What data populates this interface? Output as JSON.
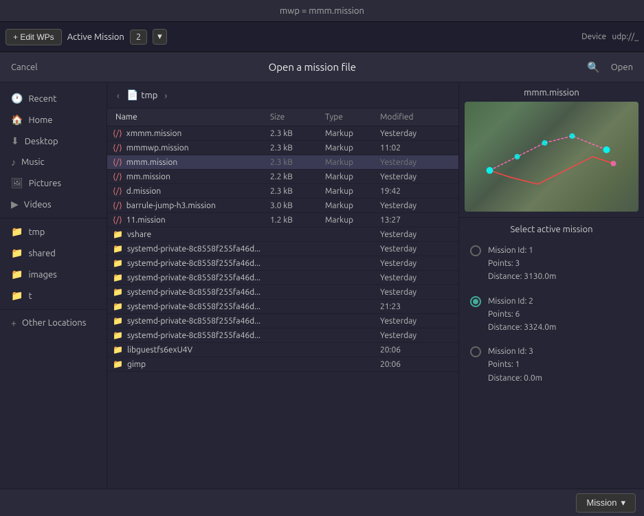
{
  "titleBar": {
    "text": "mwp = mmm.mission"
  },
  "toolbar": {
    "editWps": "+ Edit WPs",
    "activeMission": "Active Mission",
    "missionNum": "2",
    "device": "Device",
    "deviceAddr": "udp://_"
  },
  "dialog": {
    "cancel": "Cancel",
    "title": "Open a mission file",
    "open": "Open"
  },
  "pathBar": {
    "folder": "tmp"
  },
  "columns": {
    "name": "Name",
    "size": "Size",
    "type": "Type",
    "modified": "Modified"
  },
  "files": [
    {
      "name": "xmmm.mission",
      "icon": "mission",
      "size": "2.3 kB",
      "type": "Markup",
      "modified": "Yesterday",
      "selected": false
    },
    {
      "name": "mmmwp.mission",
      "icon": "mission",
      "size": "2.3 kB",
      "type": "Markup",
      "modified": "11:02",
      "selected": false
    },
    {
      "name": "mmm.mission",
      "icon": "mission",
      "size": "2.3 kB",
      "type": "Markup",
      "modified": "Yesterday",
      "selected": true
    },
    {
      "name": "mm.mission",
      "icon": "mission",
      "size": "2.2 kB",
      "type": "Markup",
      "modified": "Yesterday",
      "selected": false
    },
    {
      "name": "d.mission",
      "icon": "mission",
      "size": "2.3 kB",
      "type": "Markup",
      "modified": "19:42",
      "selected": false
    },
    {
      "name": "barrule-jump-h3.mission",
      "icon": "mission",
      "size": "3.0 kB",
      "type": "Markup",
      "modified": "Yesterday",
      "selected": false
    },
    {
      "name": "11.mission",
      "icon": "mission",
      "size": "1.2 kB",
      "type": "Markup",
      "modified": "13:27",
      "selected": false
    },
    {
      "name": "vshare",
      "icon": "folder",
      "size": "",
      "type": "",
      "modified": "Yesterday",
      "selected": false
    },
    {
      "name": "systemd-private-8c8558f255fa46d...",
      "icon": "folder",
      "size": "",
      "type": "",
      "modified": "Yesterday",
      "selected": false
    },
    {
      "name": "systemd-private-8c8558f255fa46d...",
      "icon": "folder",
      "size": "",
      "type": "",
      "modified": "Yesterday",
      "selected": false
    },
    {
      "name": "systemd-private-8c8558f255fa46d...",
      "icon": "folder",
      "size": "",
      "type": "",
      "modified": "Yesterday",
      "selected": false
    },
    {
      "name": "systemd-private-8c8558f255fa46d...",
      "icon": "folder",
      "size": "",
      "type": "",
      "modified": "Yesterday",
      "selected": false
    },
    {
      "name": "systemd-private-8c8558f255fa46d...",
      "icon": "folder",
      "size": "",
      "type": "",
      "modified": "21:23",
      "selected": false
    },
    {
      "name": "systemd-private-8c8558f255fa46d...",
      "icon": "folder",
      "size": "",
      "type": "",
      "modified": "Yesterday",
      "selected": false
    },
    {
      "name": "systemd-private-8c8558f255fa46d...",
      "icon": "folder",
      "size": "",
      "type": "",
      "modified": "Yesterday",
      "selected": false
    },
    {
      "name": "libguestfs6exU4V",
      "icon": "folder",
      "size": "",
      "type": "",
      "modified": "20:06",
      "selected": false
    },
    {
      "name": "gimp",
      "icon": "folder",
      "size": "",
      "type": "",
      "modified": "20:06",
      "selected": false
    }
  ],
  "sidebar": {
    "items": [
      {
        "id": "recent",
        "label": "Recent",
        "icon": "🕐"
      },
      {
        "id": "home",
        "label": "Home",
        "icon": "🏠"
      },
      {
        "id": "desktop",
        "label": "Desktop",
        "icon": "⬇"
      },
      {
        "id": "music",
        "label": "Music",
        "icon": "♪"
      },
      {
        "id": "pictures",
        "label": "Pictures",
        "icon": "🖼"
      },
      {
        "id": "videos",
        "label": "Videos",
        "icon": "▶"
      }
    ],
    "folders": [
      {
        "id": "tmp",
        "label": "tmp"
      },
      {
        "id": "shared",
        "label": "shared"
      },
      {
        "id": "images",
        "label": "images"
      },
      {
        "id": "t",
        "label": "t"
      }
    ],
    "otherLocations": "+ Other Locations"
  },
  "preview": {
    "title": "mmm.mission"
  },
  "missionSelector": {
    "title": "Select active mission",
    "missions": [
      {
        "id": 1,
        "points": 3,
        "distance": "3130.0m",
        "selected": false
      },
      {
        "id": 2,
        "points": 6,
        "distance": "3324.0m",
        "selected": true
      },
      {
        "id": 3,
        "points": 1,
        "distance": "0.0m",
        "selected": false
      }
    ]
  },
  "footer": {
    "missionBtn": "Mission"
  }
}
